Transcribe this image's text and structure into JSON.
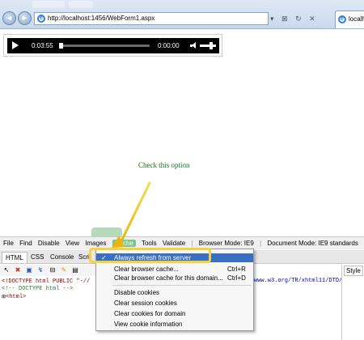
{
  "browser": {
    "address_url": "http://localhost:1456/WebForm1.aspx",
    "tab_title": "localh",
    "back_glyph": "◄",
    "forward_glyph": "►",
    "address_tools": [
      "▾",
      "⊠",
      "↻",
      "✕"
    ]
  },
  "player": {
    "elapsed": "0:03:55",
    "remaining": "0:00:00",
    "progress_fraction": 0.0,
    "volume_fraction": 0.7
  },
  "annotation": {
    "text": "Check this option",
    "color": "#17701c"
  },
  "devtools": {
    "menu": {
      "file": "File",
      "find": "Find",
      "disable": "Disable",
      "view": "View",
      "images": "Images",
      "cache": "Cache",
      "tools": "Tools",
      "validate": "Validate",
      "browser_mode": "Browser Mode: IE9",
      "document_mode": "Document Mode: IE9 standards"
    },
    "tabs": {
      "html": "HTML",
      "css": "CSS",
      "console": "Console",
      "script": "Scri"
    },
    "style_tab": "Style",
    "code_lines": {
      "doctype": "<!DOCTYPE html PUBLIC \"-//",
      "comment": "<!-- DOCTYPE html -->",
      "html_tag": "<html>"
    },
    "url_fragment": "www.w3.org/TR/xhtml11/DTD/x"
  },
  "cache_menu": {
    "always_refresh": "Always refresh from server",
    "clear_cache": "Clear browser cache...",
    "clear_cache_shortcut": "Ctrl+R",
    "clear_cache_domain": "Clear browser cache for this domain...",
    "clear_cache_domain_shortcut": "Ctrl+D",
    "disable_cookies": "Disable cookies",
    "clear_session_cookies": "Clear session cookies",
    "clear_cookies_domain": "Clear cookies for domain",
    "view_cookie_info": "View cookie information",
    "check_glyph": "✓"
  },
  "colors": {
    "highlight_box": "#f2d243",
    "arrow": "#f2c30f",
    "menu_highlight": "#3a6fc4",
    "cache_active": "#7dc48a"
  }
}
